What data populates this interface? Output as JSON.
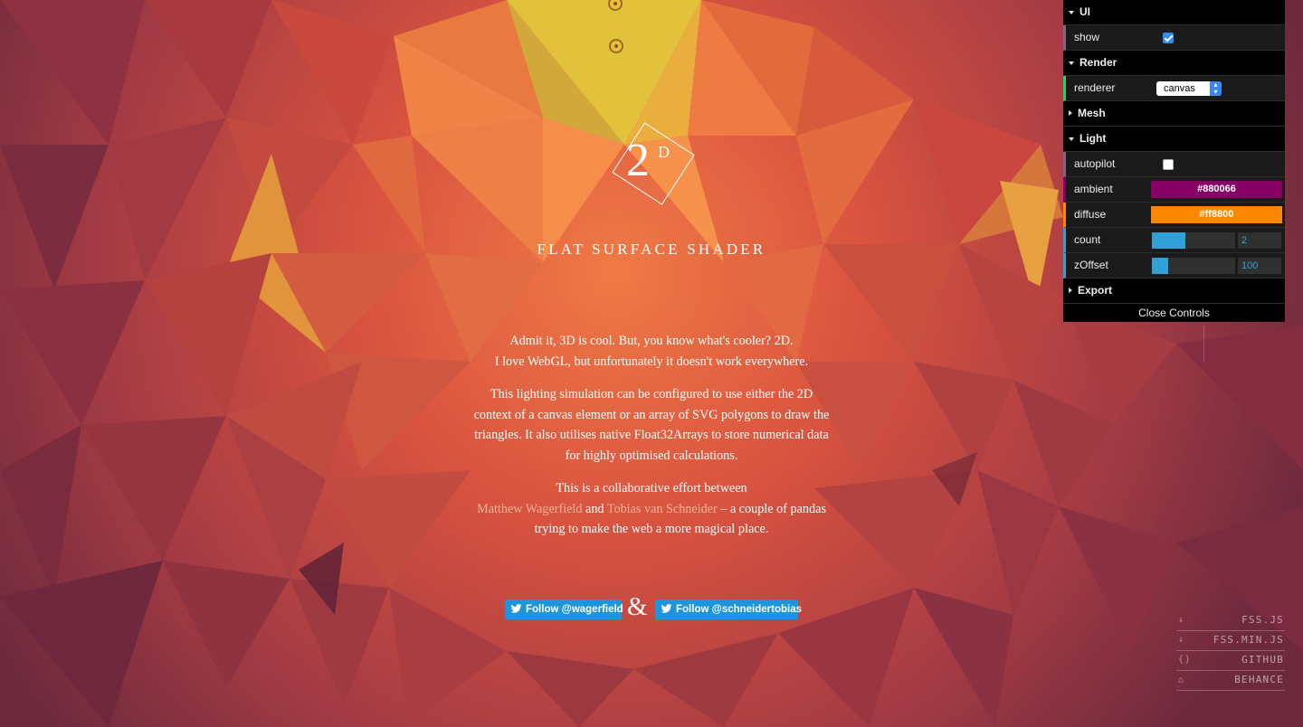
{
  "logo": {
    "main": "2",
    "superscript": "D"
  },
  "title": "FLAT SURFACE SHADER",
  "intro": {
    "line1": "Admit it, 3D is cool. But, you know what's cooler? 2D.",
    "line2": "I love WebGL, but unfortunately it doesn't work everywhere."
  },
  "description": "This lighting simulation can be configured to use either the 2D context of a canvas element or an array of SVG polygons to draw the triangles. It also utilises native Float32Arrays to store numerical data for highly optimised calculations.",
  "credits": {
    "prefix": "This is a collaborative effort between",
    "author1": "Matthew Wagerfield",
    "and": "and",
    "author2": "Tobias van Schneider",
    "suffix": "– a couple of pandas trying to make the web a more magical place."
  },
  "follow": {
    "button1": "Follow @wagerfield",
    "ampersand": "&",
    "button2": "Follow @schneidertobias"
  },
  "controls": {
    "ui_folder": "UI",
    "show_label": "show",
    "show_checked": true,
    "render_folder": "Render",
    "renderer_label": "renderer",
    "renderer_value": "canvas",
    "mesh_folder": "Mesh",
    "light_folder": "Light",
    "autopilot_label": "autopilot",
    "autopilot_checked": false,
    "ambient_label": "ambient",
    "ambient_value": "#880066",
    "diffuse_label": "diffuse",
    "diffuse_value": "#ff8800",
    "count_label": "count",
    "count_value": "2",
    "count_level": 0.4,
    "zoffset_label": "zOffset",
    "zoffset_value": "100",
    "zoffset_level": 0.2,
    "export_folder": "Export",
    "close_label": "Close Controls"
  },
  "links": [
    {
      "label": "FSS.JS",
      "icon": "download-icon",
      "glyph": "↓"
    },
    {
      "label": "FSS.MIN.JS",
      "icon": "download-icon",
      "glyph": "↓"
    },
    {
      "label": "GITHUB",
      "icon": "code-icon",
      "glyph": "{}"
    },
    {
      "label": "BEHANCE",
      "icon": "triangle-icon",
      "glyph": "△"
    }
  ],
  "colors": {
    "accent_blue": "#2fa1d6",
    "twitter_blue": "#1d95de",
    "ambient": "#880066",
    "diffuse": "#ff8800"
  }
}
